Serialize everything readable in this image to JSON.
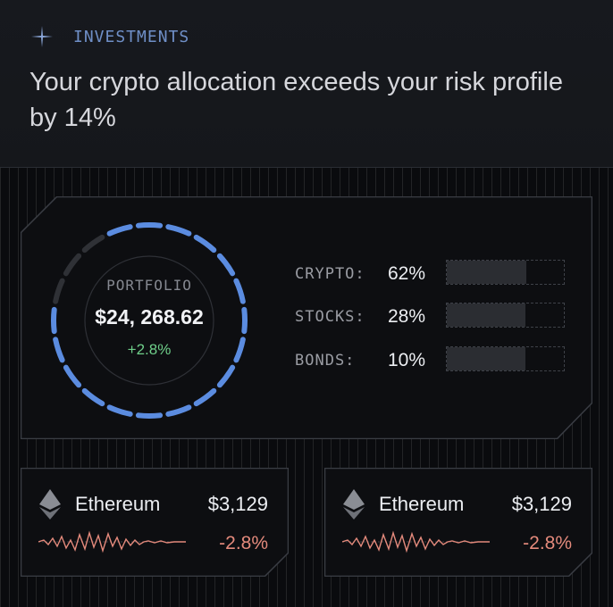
{
  "header": {
    "eyebrow": "INVESTMENTS",
    "headline": "Your crypto allocation exceeds your risk profile by 14%",
    "sparkle_icon": "sparkle-icon",
    "eyebrow_color": "#6f8fc7"
  },
  "portfolio": {
    "label": "PORTFOLIO",
    "value": "$24, 268.62",
    "change": "+2.8%",
    "change_color": "#6fcf8a",
    "ring_color": "#5b8ce0"
  },
  "allocation": [
    {
      "label": "CRYPTO:",
      "value": "62%",
      "fill": 0.68
    },
    {
      "label": "STOCKS:",
      "value": "28%",
      "fill": 0.67
    },
    {
      "label": "BONDS:",
      "value": "10%",
      "fill": 0.67
    }
  ],
  "coins": [
    {
      "name": "Ethereum",
      "price": "$3,129",
      "change": "-2.8%",
      "icon": "ethereum-icon"
    },
    {
      "name": "Ethereum",
      "price": "$3,129",
      "change": "-2.8%",
      "icon": "ethereum-icon"
    }
  ],
  "colors": {
    "negative": "#e48a7c",
    "positive": "#6fcf8a",
    "background": "#0b0c0f"
  }
}
